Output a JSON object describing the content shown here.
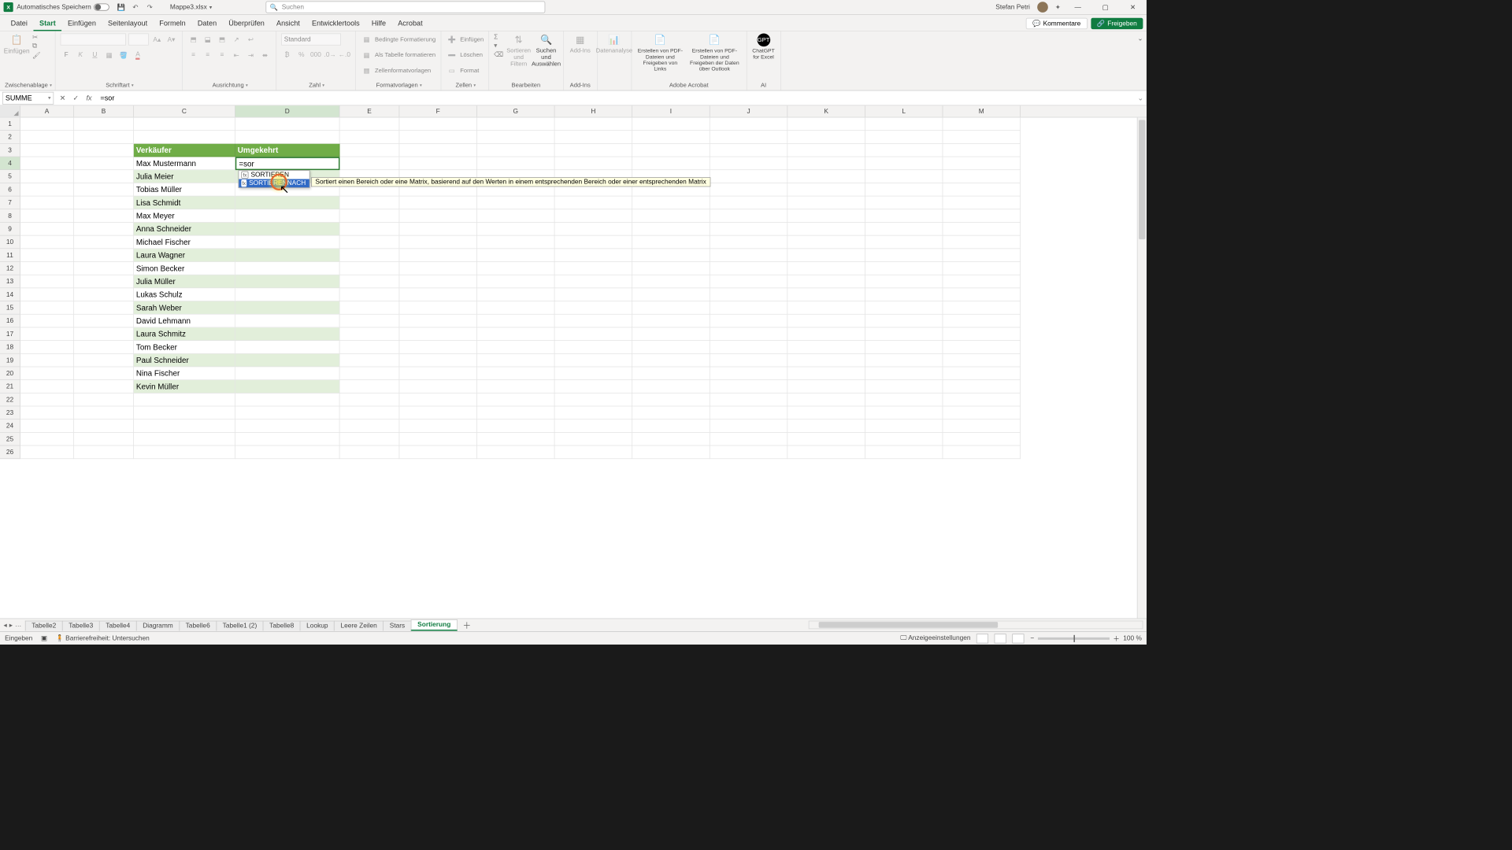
{
  "titlebar": {
    "autosave_label": "Automatisches Speichern",
    "doc_name": "Mappe3.xlsx",
    "search_placeholder": "Suchen",
    "user_name": "Stefan Petri"
  },
  "menu": {
    "tabs": [
      "Datei",
      "Start",
      "Einfügen",
      "Seitenlayout",
      "Formeln",
      "Daten",
      "Überprüfen",
      "Ansicht",
      "Entwicklertools",
      "Hilfe",
      "Acrobat"
    ],
    "active": "Start",
    "comments": "Kommentare",
    "share": "Freigeben"
  },
  "ribbon": {
    "clipboard": {
      "paste": "Einfügen",
      "label": "Zwischenablage"
    },
    "font": {
      "label": "Schriftart"
    },
    "alignment": {
      "label": "Ausrichtung"
    },
    "number": {
      "format": "Standard",
      "label": "Zahl"
    },
    "styles": {
      "cond": "Bedingte Formatierung",
      "table": "Als Tabelle formatieren",
      "cellstyles": "Zellenformatvorlagen",
      "label": "Formatvorlagen"
    },
    "cells": {
      "insert": "Einfügen",
      "delete": "Löschen",
      "format": "Format",
      "label": "Zellen"
    },
    "editing": {
      "sortfilter": "Sortieren und Filtern",
      "findselect": "Suchen und Auswählen",
      "label": "Bearbeiten"
    },
    "addins": {
      "addins": "Add-Ins",
      "label": "Add-Ins"
    },
    "analysis": {
      "btn": "Datenanalyse"
    },
    "acrobat": {
      "btn1": "Erstellen von PDF-Dateien und Freigeben von Links",
      "btn2": "Erstellen von PDF-Dateien und Freigeben der Daten über Outlook",
      "label": "Adobe Acrobat"
    },
    "ai": {
      "btn": "ChatGPT for Excel",
      "label": "AI"
    }
  },
  "formula_bar": {
    "name_box": "SUMME",
    "formula": "=sor"
  },
  "columns": [
    "A",
    "B",
    "C",
    "D",
    "E",
    "F",
    "G",
    "H",
    "I",
    "J",
    "K",
    "L",
    "M"
  ],
  "grid": {
    "header": {
      "c": "Verkäufer",
      "d": "Umgekehrt"
    },
    "active_cell_value": "=sor",
    "names": [
      "Max Mustermann",
      "Julia Meier",
      "Tobias Müller",
      "Lisa Schmidt",
      "Max Meyer",
      "Anna Schneider",
      "Michael Fischer",
      "Laura Wagner",
      "Simon Becker",
      "Julia Müller",
      "Lukas Schulz",
      "Sarah Weber",
      "David Lehmann",
      "Laura Schmitz",
      "Tom Becker",
      "Paul Schneider",
      "Nina Fischer",
      "Kevin Müller"
    ]
  },
  "autocomplete": {
    "item1": "SORTIEREN",
    "item2": "SORTIERENNACH",
    "tooltip": "Sortiert einen Bereich oder eine Matrix, basierend auf den Werten in einem entsprechenden Bereich oder einer entsprechenden Matrix"
  },
  "sheets": {
    "tabs": [
      "Tabelle2",
      "Tabelle3",
      "Tabelle4",
      "Diagramm",
      "Tabelle6",
      "Tabelle1 (2)",
      "Tabelle8",
      "Lookup",
      "Leere Zeilen",
      "Stars",
      "Sortierung"
    ],
    "active": "Sortierung"
  },
  "statusbar": {
    "mode": "Eingeben",
    "accessibility": "Barrierefreiheit: Untersuchen",
    "display_settings": "Anzeigeeinstellungen",
    "zoom": "100 %"
  }
}
